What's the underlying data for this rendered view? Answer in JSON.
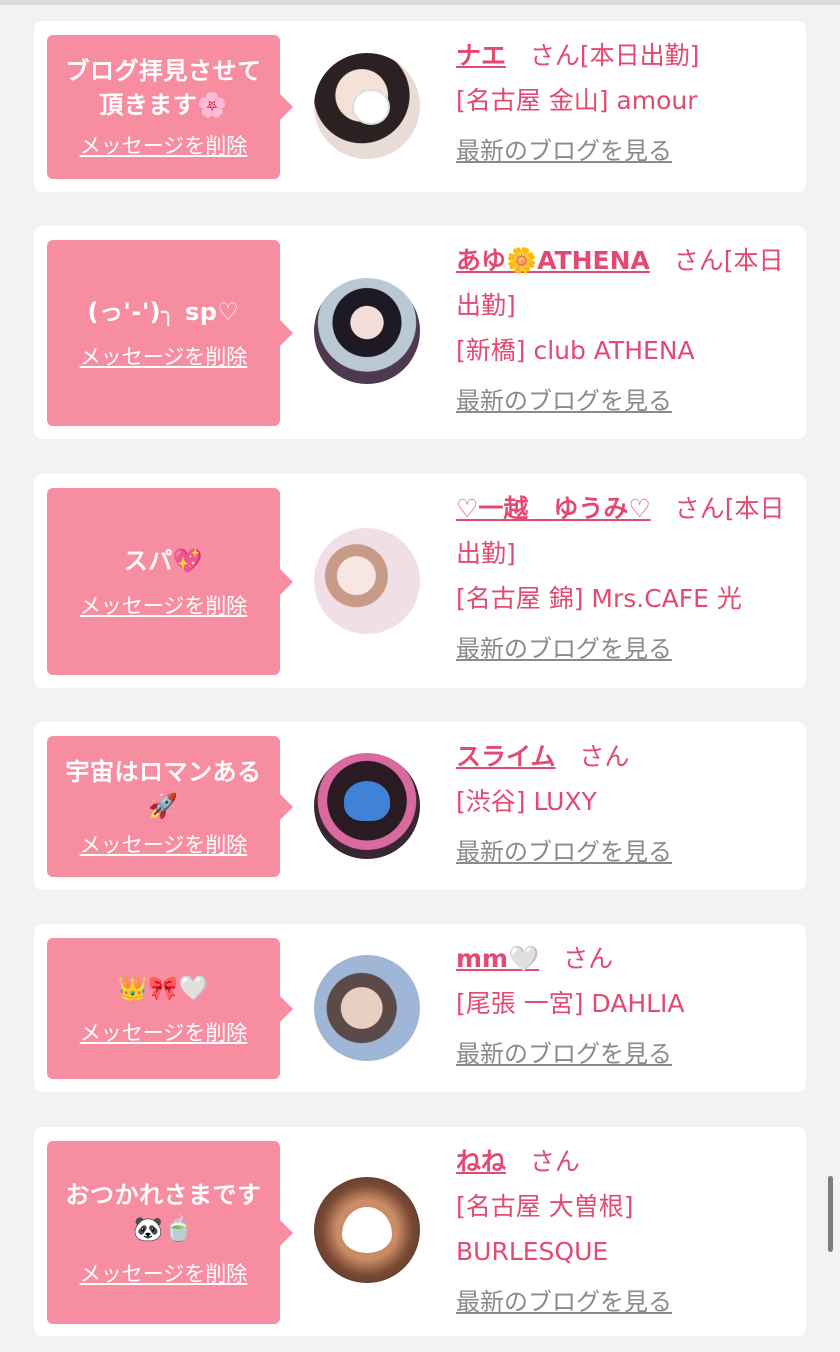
{
  "labels": {
    "delete_message": "メッセージを削除",
    "latest_blog": "最新のブログを見る",
    "honorific": "さん"
  },
  "colors": {
    "accent": "#e24a73",
    "bubble": "#f78da0",
    "link_gray": "#8a8a8a",
    "background": "#f2f2f2"
  },
  "items": [
    {
      "message": "ブログ拝見させて\n頂きます🌸",
      "name": "ナエ",
      "status": "[本日出勤]",
      "shop": "[名古屋 金山] amour",
      "avatar": "photo-avatar-1"
    },
    {
      "message": "(っ'-')╮ sp♡",
      "name": "あゆ🌼ATHENA",
      "status": "[本日出勤]",
      "shop": "[新橋] club ATHENA",
      "avatar": "photo-avatar-2"
    },
    {
      "message": "スパ💖",
      "name": "♡一越　ゆうみ♡",
      "status": "[本日出勤]",
      "shop": "[名古屋 錦] Mrs.CAFE 光",
      "avatar": "photo-avatar-3"
    },
    {
      "message": "宇宙はロマンある\n🚀",
      "name": "スライム",
      "status": "",
      "shop": "[渋谷] LUXY",
      "avatar": "photo-avatar-4"
    },
    {
      "message": "👑🎀🤍",
      "name": "mm🤍",
      "status": "",
      "shop": "[尾張 一宮] DAHLIA",
      "avatar": "photo-avatar-5"
    },
    {
      "message": "おつかれさまです\n🐼🍵",
      "name": "ねね",
      "status": "",
      "shop": "[名古屋 大曽根] BURLESQUE",
      "avatar": "photo-avatar-6"
    }
  ]
}
